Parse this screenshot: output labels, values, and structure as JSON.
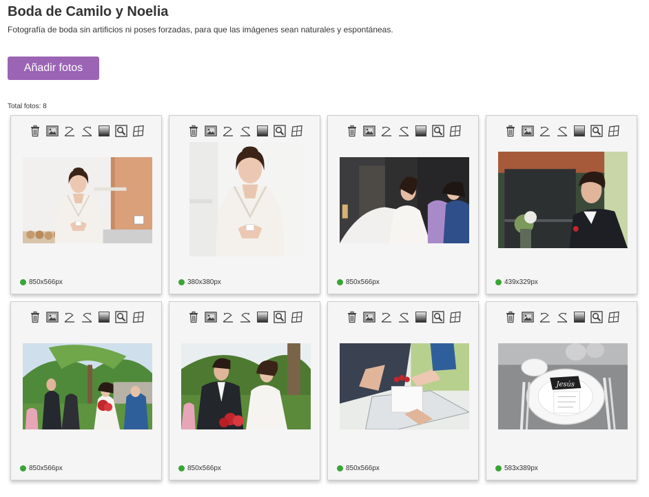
{
  "header": {
    "title": "Boda de Camilo y Noelia",
    "subtitle": "Fotografía de boda sin artificios ni poses forzadas, para que las imágenes sean naturales y espontáneas."
  },
  "actions": {
    "add_photos_label": "Añadir fotos"
  },
  "gallery": {
    "total_label": "Total fotos: 8",
    "toolbar_icons": [
      "trash-icon",
      "image-icon",
      "rotate-left-icon",
      "rotate-right-icon",
      "grayscale-icon",
      "zoom-icon",
      "crop-icon"
    ],
    "photos": [
      {
        "size": "850x566px",
        "status_color": "#39a535",
        "scene": "bride-robe"
      },
      {
        "size": "380x380px",
        "status_color": "#39a535",
        "scene": "bride-robe-square"
      },
      {
        "size": "850x566px",
        "status_color": "#39a535",
        "scene": "bride-dress-help"
      },
      {
        "size": "439x329px",
        "status_color": "#39a535",
        "scene": "groom-portrait"
      },
      {
        "size": "850x566px",
        "status_color": "#39a535",
        "scene": "ceremony-garden"
      },
      {
        "size": "850x566px",
        "status_color": "#39a535",
        "scene": "rings-exchange"
      },
      {
        "size": "850x566px",
        "status_color": "#39a535",
        "scene": "hands-gift"
      },
      {
        "size": "583x389px",
        "status_color": "#39a535",
        "scene": "table-place-card"
      }
    ],
    "place_card_text": "Jesús"
  },
  "colors": {
    "accent": "#9b64b4",
    "status_ok": "#39a535"
  }
}
